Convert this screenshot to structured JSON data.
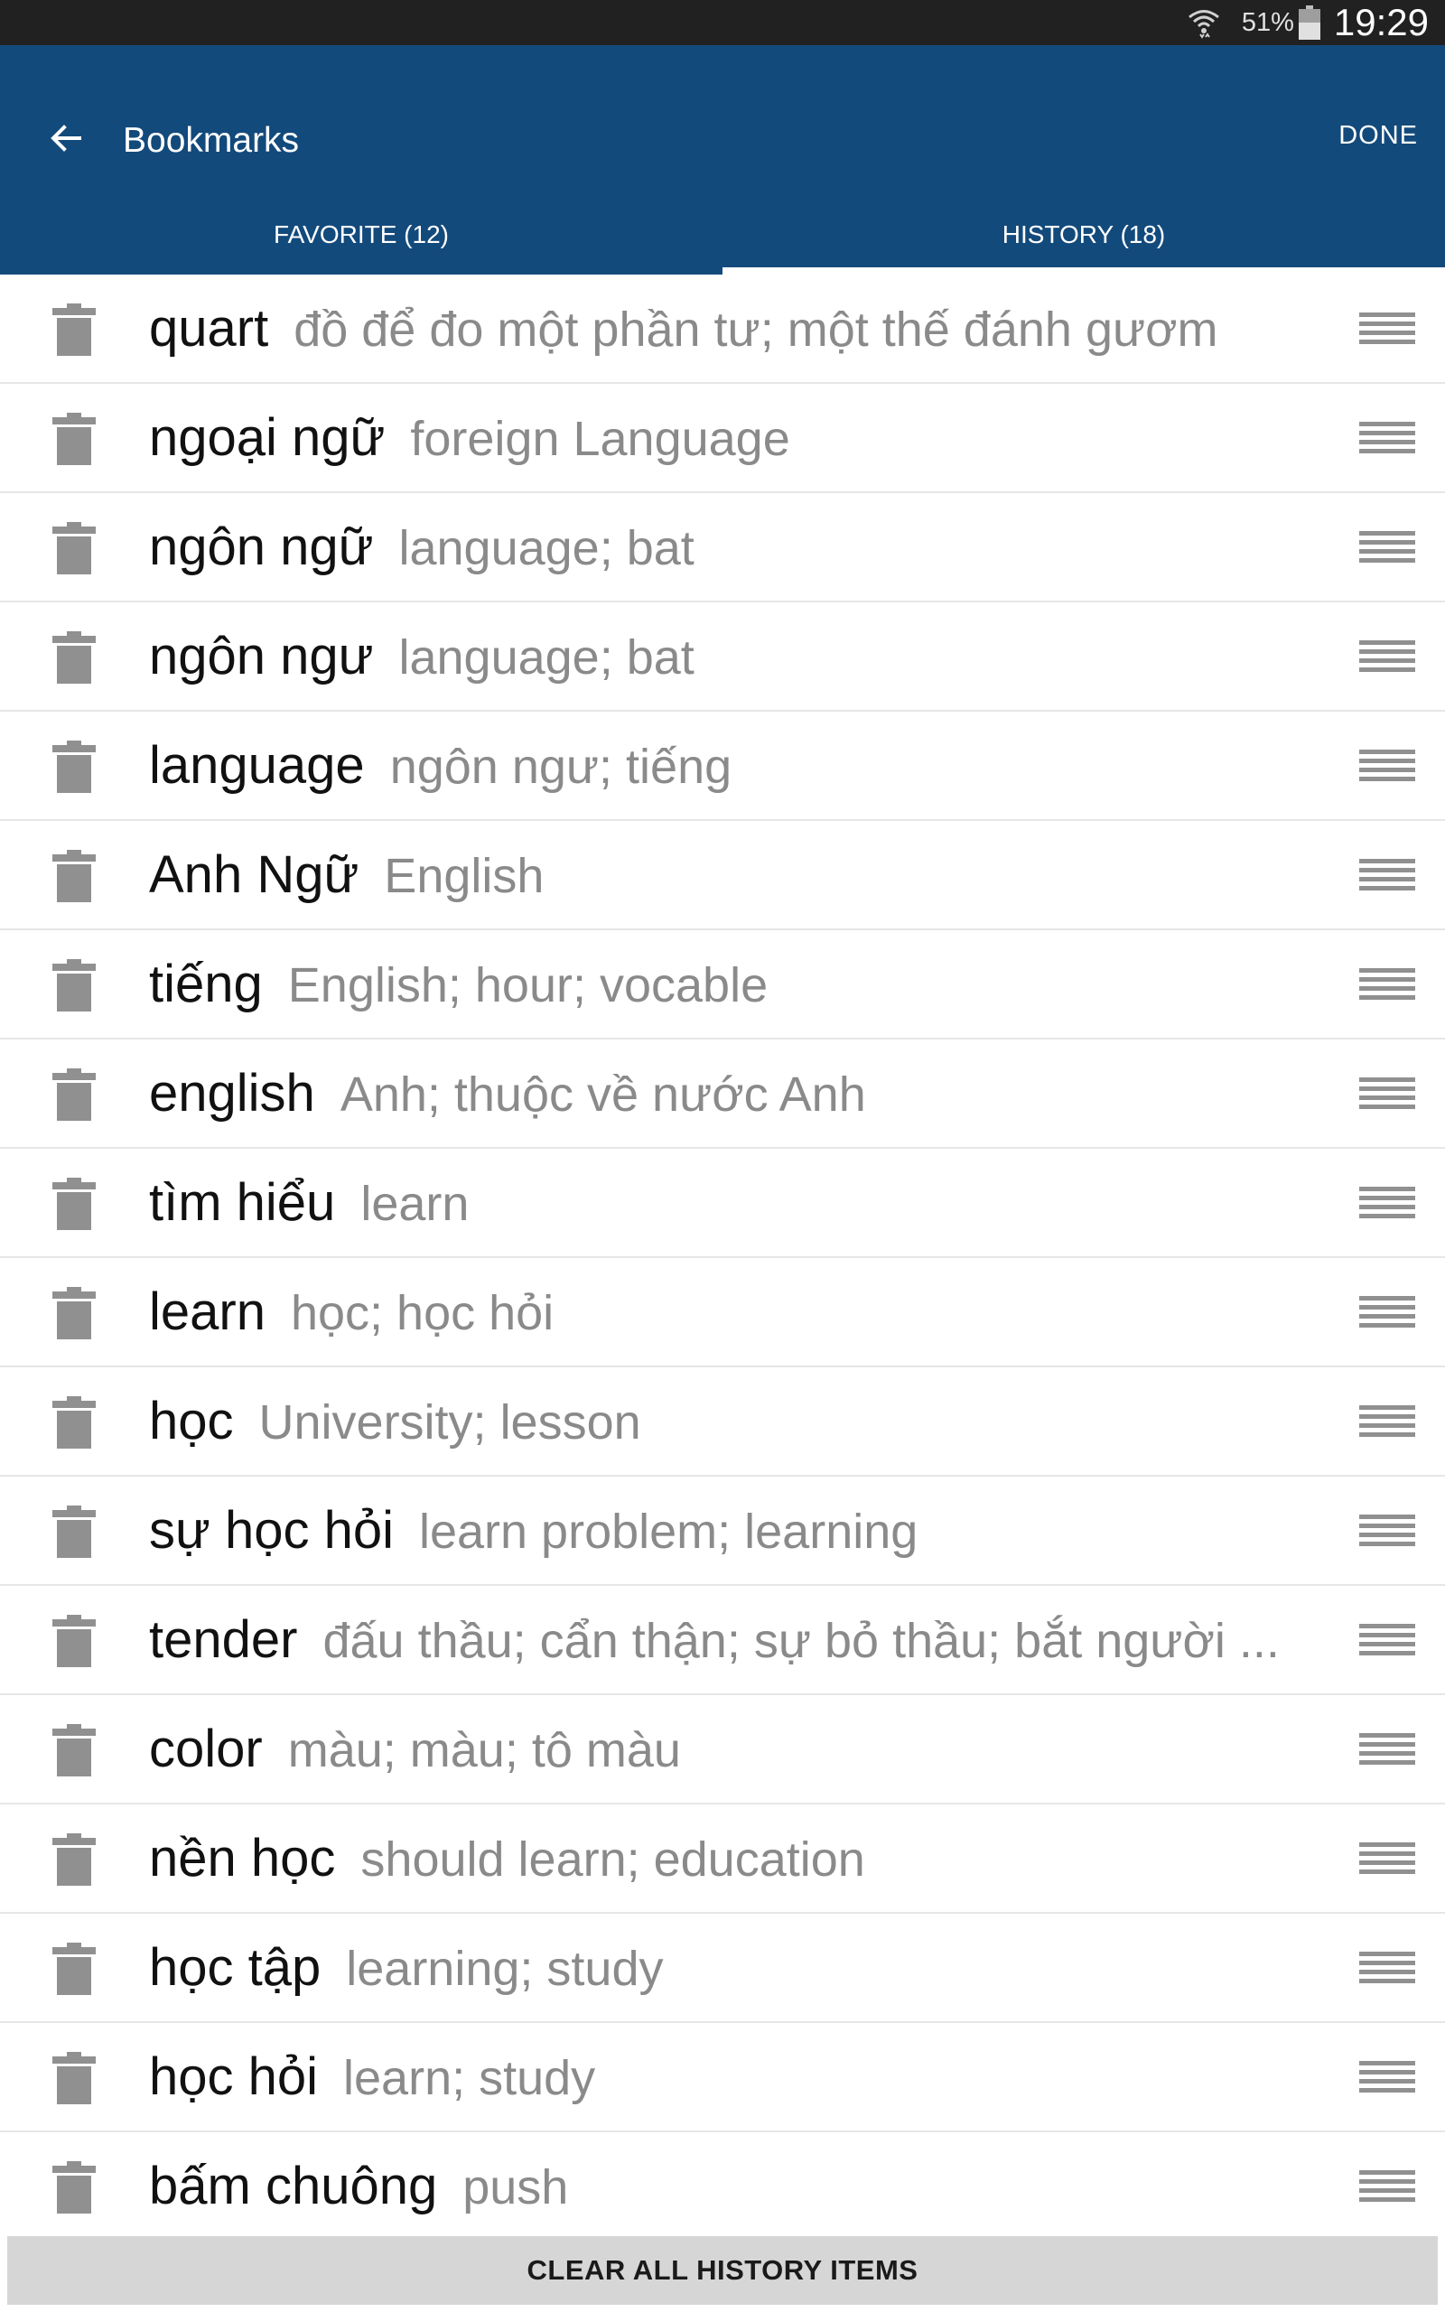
{
  "status_bar": {
    "battery_pct": "51%",
    "time": "19:29"
  },
  "header": {
    "title": "Bookmarks",
    "done_label": "DONE"
  },
  "tabs": [
    {
      "label": "FAVORITE (12)",
      "active": false
    },
    {
      "label": "HISTORY (18)",
      "active": true
    }
  ],
  "history": [
    {
      "term": "quart",
      "meaning": "đồ để đo một phần tư; một thế đánh gươm"
    },
    {
      "term": "ngoại ngữ",
      "meaning": "foreign Language"
    },
    {
      "term": "ngôn ngữ",
      "meaning": "language; bat"
    },
    {
      "term": "ngôn ngư",
      "meaning": "language; bat"
    },
    {
      "term": "language",
      "meaning": "ngôn ngư; tiếng"
    },
    {
      "term": "Anh Ngữ",
      "meaning": "English"
    },
    {
      "term": "tiếng",
      "meaning": "English; hour; vocable"
    },
    {
      "term": "english",
      "meaning": "Anh; thuộc về nước Anh"
    },
    {
      "term": "tìm hiểu",
      "meaning": "learn"
    },
    {
      "term": "learn",
      "meaning": "học; học hỏi"
    },
    {
      "term": "học",
      "meaning": "University; lesson"
    },
    {
      "term": "sự học hỏi",
      "meaning": "learn problem; learning"
    },
    {
      "term": "tender",
      "meaning": "đấu thầu; cẩn thận; sự bỏ thầu; bắt người ..."
    },
    {
      "term": "color",
      "meaning": "màu; màu; tô màu"
    },
    {
      "term": "nền học",
      "meaning": "should learn; education"
    },
    {
      "term": "học tập",
      "meaning": "learning; study"
    },
    {
      "term": "học hỏi",
      "meaning": "learn; study"
    },
    {
      "term": "bấm chuông",
      "meaning": "push"
    }
  ],
  "footer": {
    "clear_label": "CLEAR ALL HISTORY ITEMS"
  },
  "colors": {
    "app_bar": "#134a7c",
    "status_bar": "#212121",
    "term": "#111111",
    "meaning": "#8a8a8a",
    "icon_gray": "#909090"
  },
  "icons": {
    "back": "arrow-left-icon",
    "delete": "trash-icon",
    "reorder": "drag-handle-icon",
    "wifi": "wifi-icon",
    "battery": "battery-icon"
  }
}
